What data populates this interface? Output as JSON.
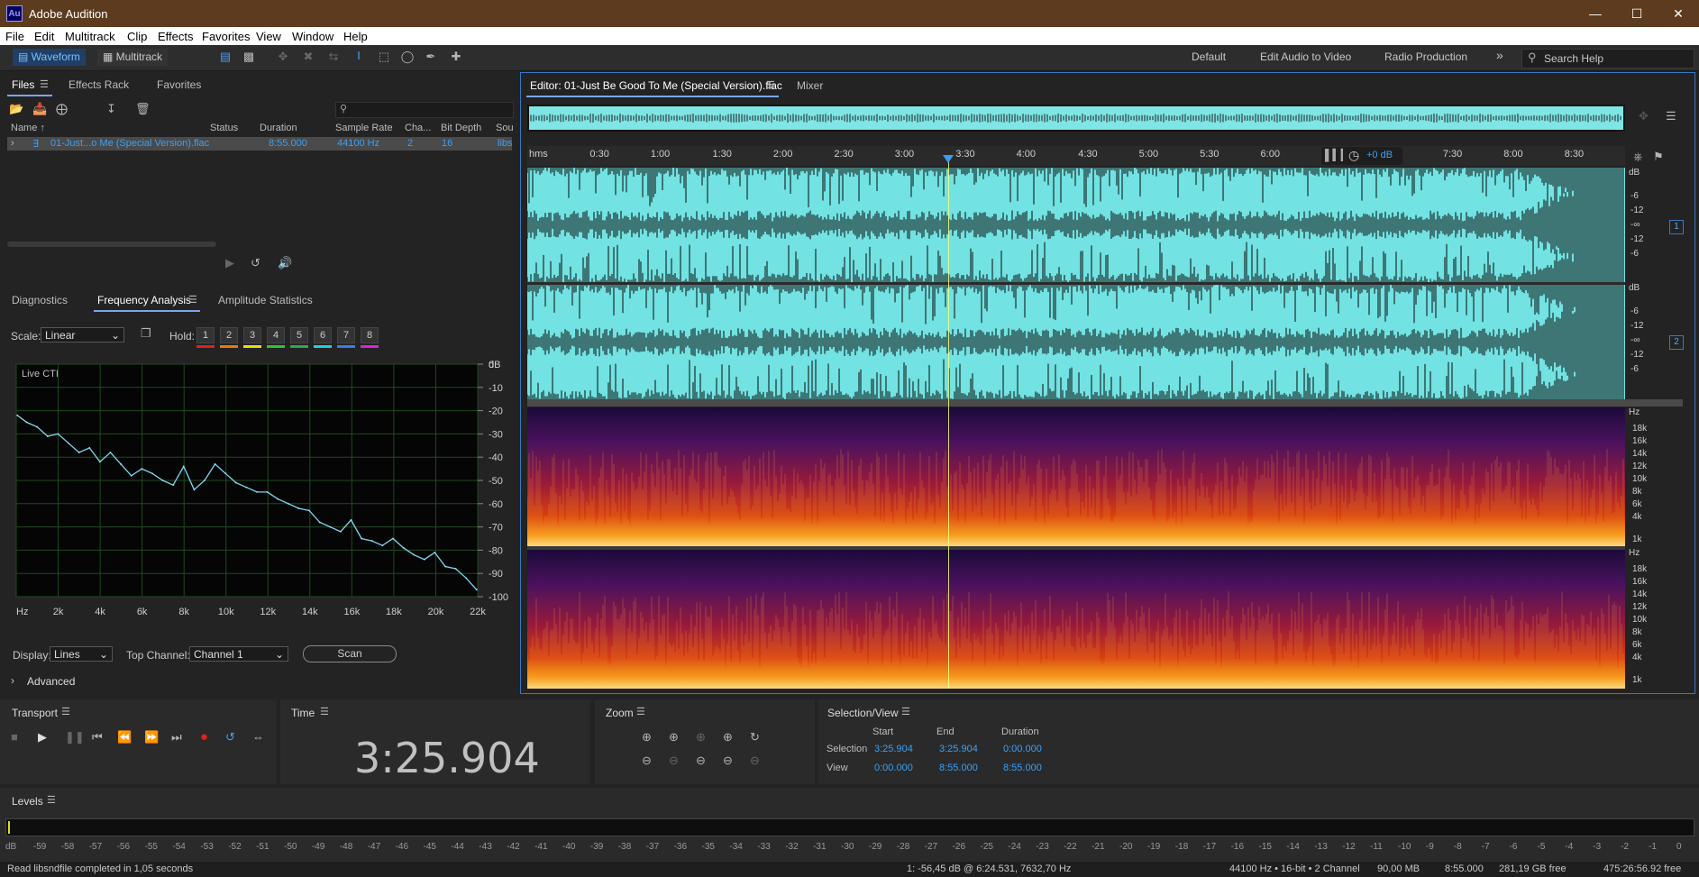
{
  "app": {
    "title": "Adobe Audition",
    "logo": "Au"
  },
  "menu": [
    "File",
    "Edit",
    "Multitrack",
    "Clip",
    "Effects",
    "Favorites",
    "View",
    "Window",
    "Help"
  ],
  "toolbar": {
    "waveform": "Waveform",
    "multitrack": "Multitrack",
    "workspaces": [
      "Default",
      "Edit Audio to Video",
      "Radio Production"
    ],
    "search_placeholder": "Search Help"
  },
  "files_panel": {
    "tabs": [
      "Files",
      "Effects Rack",
      "Favorites"
    ],
    "columns": [
      "Name ↑",
      "Status",
      "Duration",
      "Sample Rate",
      "Cha...",
      "Bit Depth",
      "Sou"
    ],
    "row": {
      "name": "01-Just...o Me (Special Version).flac",
      "status": "",
      "duration": "8:55.000",
      "sample_rate": "44100 Hz",
      "channels": "2",
      "bit_depth": "16",
      "source": "libs"
    }
  },
  "analysis_panel": {
    "tabs": [
      "Diagnostics",
      "Frequency Analysis",
      "Amplitude Statistics"
    ],
    "scale_label": "Scale:",
    "scale_value": "Linear",
    "hold_label": "Hold:",
    "hold_buttons": [
      "1",
      "2",
      "3",
      "4",
      "5",
      "6",
      "7",
      "8"
    ],
    "hold_colors": [
      "#e02020",
      "#f07800",
      "#e8e000",
      "#28c828",
      "#20b050",
      "#20d0e0",
      "#3080f0",
      "#e020e0"
    ],
    "graph_label": "Live CTI",
    "display_label": "Display:",
    "display_value": "Lines",
    "top_channel_label": "Top Channel:",
    "top_channel_value": "Channel 1",
    "scan_label": "Scan",
    "advanced_label": "Advanced"
  },
  "chart_data": {
    "type": "line",
    "title": "Live CTI",
    "xlabel": "",
    "ylabel": "dB",
    "x_ticks": [
      "Hz",
      "2k",
      "4k",
      "6k",
      "8k",
      "10k",
      "12k",
      "14k",
      "16k",
      "18k",
      "20k",
      "22k"
    ],
    "y_ticks": [
      "0",
      "-10",
      "-20",
      "-30",
      "-40",
      "-50",
      "-60",
      "-70",
      "-80",
      "-90",
      "-100"
    ],
    "xlim": [
      0,
      22050
    ],
    "ylim": [
      -100,
      0
    ],
    "series": [
      {
        "x": [
          50,
          500,
          1000,
          1500,
          2000,
          2500,
          3000,
          3500,
          4000,
          4500,
          5000,
          5500,
          6000,
          6500,
          7000,
          7500,
          8000,
          8500,
          9000,
          9500,
          10000,
          10500,
          11000,
          11500,
          12000,
          12500,
          13000,
          13500,
          14000,
          14500,
          15000,
          15500,
          16000,
          16500,
          17000,
          17500,
          18000,
          18500,
          19000,
          19500,
          20000,
          20500,
          21000,
          21500,
          22000
        ],
        "y": [
          -22,
          -25,
          -27,
          -31,
          -30,
          -34,
          -38,
          -36,
          -42,
          -38,
          -43,
          -48,
          -45,
          -47,
          -50,
          -52,
          -44,
          -54,
          -50,
          -43,
          -47,
          -51,
          -53,
          -55,
          -55,
          -58,
          -60,
          -62,
          -63,
          -68,
          -70,
          -72,
          -67,
          -75,
          -76,
          -78,
          -75,
          -79,
          -82,
          -84,
          -81,
          -87,
          -88,
          -92,
          -97
        ]
      }
    ]
  },
  "editor": {
    "tabs": [
      "Editor: 01-Just Be Good To Me (Special Version).flac",
      "Mixer"
    ],
    "ruler": [
      "hms",
      "0:30",
      "1:00",
      "1:30",
      "2:00",
      "2:30",
      "3:00",
      "3:30",
      "4:00",
      "4:30",
      "5:00",
      "5:30",
      "6:00",
      "7:30",
      "8:00",
      "8:30"
    ],
    "gain": "+0 dB",
    "db_labels": [
      "dB",
      "-6",
      "-12",
      "-∞",
      "-12",
      "-6"
    ],
    "spec_labels": [
      "Hz",
      "18k",
      "16k",
      "14k",
      "12k",
      "10k",
      "8k",
      "6k",
      "4k",
      "1k"
    ],
    "channel_badges": [
      "1",
      "2"
    ]
  },
  "transport": {
    "title": "Transport"
  },
  "time": {
    "title": "Time",
    "value": "3:25.904"
  },
  "zoom": {
    "title": "Zoom"
  },
  "selection_view": {
    "title": "Selection/View",
    "cols": [
      "Start",
      "End",
      "Duration"
    ],
    "rows": [
      {
        "label": "Selection",
        "start": "3:25.904",
        "end": "3:25.904",
        "duration": "0:00.000"
      },
      {
        "label": "View",
        "start": "0:00.000",
        "end": "8:55.000",
        "duration": "8:55.000"
      }
    ]
  },
  "levels": {
    "title": "Levels",
    "ticks": [
      "dB",
      "-59",
      "-58",
      "-57",
      "-56",
      "-55",
      "-54",
      "-53",
      "-52",
      "-51",
      "-50",
      "-49",
      "-48",
      "-47",
      "-46",
      "-45",
      "-44",
      "-43",
      "-42",
      "-41",
      "-40",
      "-39",
      "-38",
      "-37",
      "-36",
      "-35",
      "-34",
      "-33",
      "-32",
      "-31",
      "-30",
      "-29",
      "-28",
      "-27",
      "-26",
      "-25",
      "-24",
      "-23",
      "-22",
      "-21",
      "-20",
      "-19",
      "-18",
      "-17",
      "-16",
      "-15",
      "-14",
      "-13",
      "-12",
      "-11",
      "-10",
      "-9",
      "-8",
      "-7",
      "-6",
      "-5",
      "-4",
      "-3",
      "-2",
      "-1",
      "0"
    ]
  },
  "status": {
    "message": "Read libsndfile completed in 1,05 seconds",
    "cursor": "1: -56,45 dB @ 6:24.531, 7632,70 Hz",
    "format": "44100 Hz • 16-bit • 2 Channel",
    "size": "90,00 MB",
    "duration": "8:55.000",
    "free": "281,19 GB free",
    "remaining": "475:26:56.92 free"
  },
  "colors": {
    "accent": "#3ba0f7",
    "waveform": "#72e0e0",
    "title_bar": "#5c3b1e"
  }
}
